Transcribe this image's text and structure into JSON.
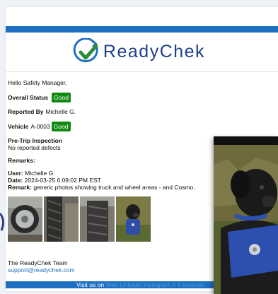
{
  "colors": {
    "brand_blue": "#1e6fc0",
    "brand_green": "#2e8b3a",
    "good_green": "#118a11",
    "link_blue": "#1e73be"
  },
  "logo": {
    "text": "ReadyChek",
    "icon": "check-circle-icon"
  },
  "greeting": "Hello Safety Manager,",
  "overall": {
    "label": "Overall Status",
    "status": "Good"
  },
  "reported": {
    "label": "Reported By",
    "value": "Michelle G."
  },
  "vehicle": {
    "label": "Vehicle",
    "value": "A-0003",
    "status": "Good"
  },
  "inspection": {
    "title": "Pre-Trip Inspection",
    "detail": "No reported defects"
  },
  "remarks": {
    "title": "Remarks:",
    "user_label": "User:",
    "user": "Michelle G.",
    "date_label": "Date:",
    "date": "2024-03-25 6:09:02 PM EST",
    "remark_label": "Remark:",
    "remark": "generic photos showing truck and wheel areas - and Cosmo."
  },
  "thumbnails": [
    "wheel-photo",
    "tire-tread-photo",
    "tire-closeup-photo",
    "dog-photo"
  ],
  "footer": {
    "team": "The ReadyChek Team",
    "email": "support@readychek.com"
  },
  "social": {
    "prefix": "Visit us on",
    "links": "Web Linkedin Instagram X Facebook"
  }
}
